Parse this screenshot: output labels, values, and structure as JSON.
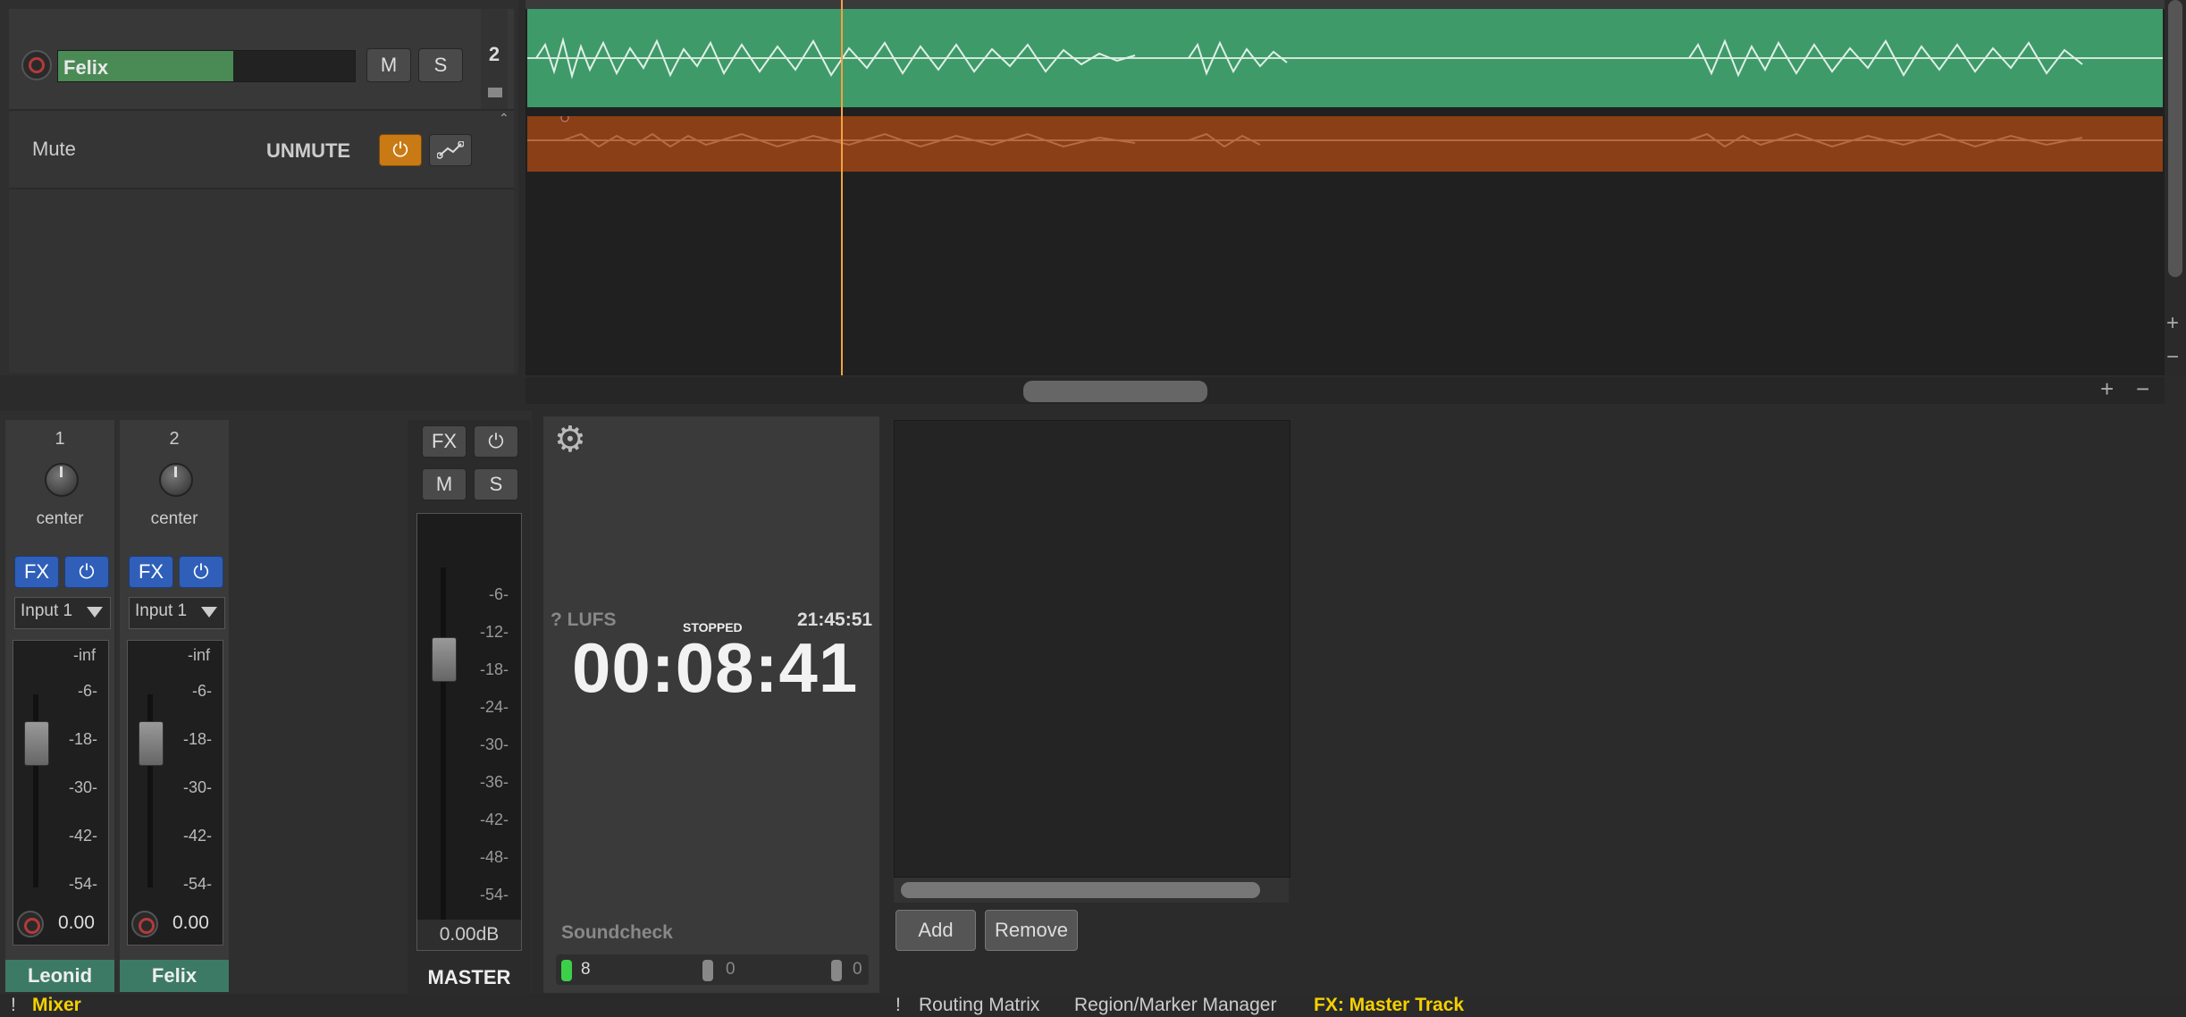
{
  "tracks": [
    {
      "name": "Felix",
      "number": "2",
      "mute_label": "M",
      "solo_label": "S"
    }
  ],
  "envelope_lane": {
    "name": "Mute",
    "value": "UNMUTE"
  },
  "mixer": {
    "strips": [
      {
        "number": "1",
        "pan": "center",
        "fx_label": "FX",
        "input": "Input 1",
        "peak": "-inf",
        "volume": "0.00",
        "name": "Leonid"
      },
      {
        "number": "2",
        "pan": "center",
        "fx_label": "FX",
        "input": "Input 1",
        "peak": "-inf",
        "volume": "0.00",
        "name": "Felix"
      }
    ],
    "strip_scale": [
      "-6-",
      "-18-",
      "-30-",
      "-42-",
      "-54-"
    ],
    "master": {
      "fx_label": "FX",
      "mute_label": "M",
      "solo_label": "S",
      "scale": [
        "-6-",
        "-12-",
        "-18-",
        "-24-",
        "-30-",
        "-36-",
        "-42-",
        "-48-",
        "-54-"
      ],
      "volume": "0.00dB",
      "name": "MASTER"
    }
  },
  "transport": {
    "lufs": "? LUFS",
    "state": "STOPPED",
    "clock": "21:45:51",
    "time": "00:08:41",
    "soundcheck_label": "Soundcheck",
    "soundcheck_values": [
      "8",
      "0",
      "0"
    ]
  },
  "fx_chain": {
    "add_label": "Add",
    "remove_label": "Remove"
  },
  "tabs": {
    "left": [
      {
        "bang": "!",
        "label": "Mixer"
      }
    ],
    "right_bang": "!",
    "right": [
      "Routing Matrix",
      "Region/Marker Manager",
      "FX: Master Track"
    ]
  },
  "colors": {
    "item_green": "#3f9a6a",
    "item_orange": "#8a3f16",
    "playhead": "#f5a142",
    "active_tab": "#f5d000",
    "fx_blue": "#2f5fb8",
    "arm_orange": "#c97a14"
  }
}
